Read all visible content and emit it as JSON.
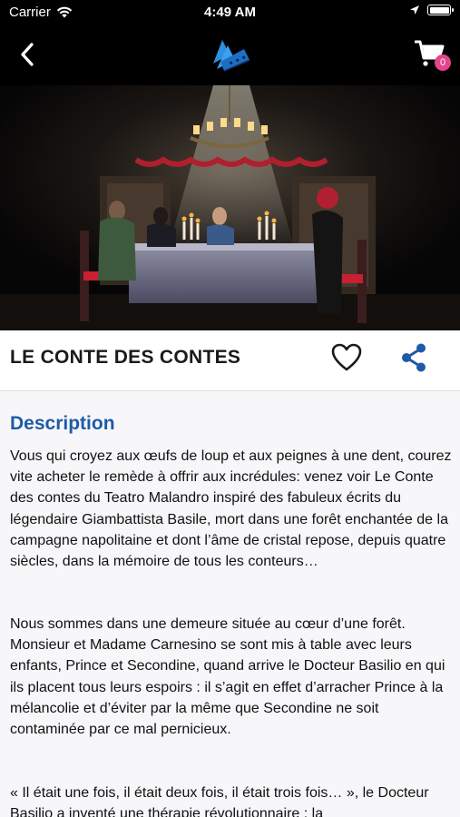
{
  "status_bar": {
    "carrier": "Carrier",
    "time": "4:49 AM"
  },
  "nav": {
    "cart_count": "0"
  },
  "show": {
    "title": "LE CONTE DES CONTES"
  },
  "description": {
    "heading": "Description",
    "paragraphs": [
      "Vous qui croyez aux œufs de loup et aux peignes à une dent, courez vite acheter le remède à offrir aux incrédules: venez voir Le Conte des contes du Teatro Malandro inspiré des fabuleux écrits du légendaire Giambattista Basile, mort dans une forêt enchantée de la campagne napolitaine et dont l’âme de cristal repose, depuis quatre siècles, dans la mémoire de tous les conteurs…",
      "Nous sommes dans une demeure située au cœur d’une forêt. Monsieur et Madame Carnesino se sont mis à table avec leurs enfants, Prince et Secondine, quand arrive le Docteur Basilio en qui ils placent tous leurs espoirs : il s’agit en effet d’arracher Prince à la mélancolie et d’éviter par la même que Secondine ne soit contaminée par ce mal pernicieux.",
      "« Il était une fois, il était deux fois, il était trois fois… », le Docteur Basilio a inventé une thérapie révolutionnaire : la"
    ]
  },
  "colors": {
    "accent": "#1e5aa8",
    "badge": "#e2458b",
    "bar": "#000000"
  }
}
